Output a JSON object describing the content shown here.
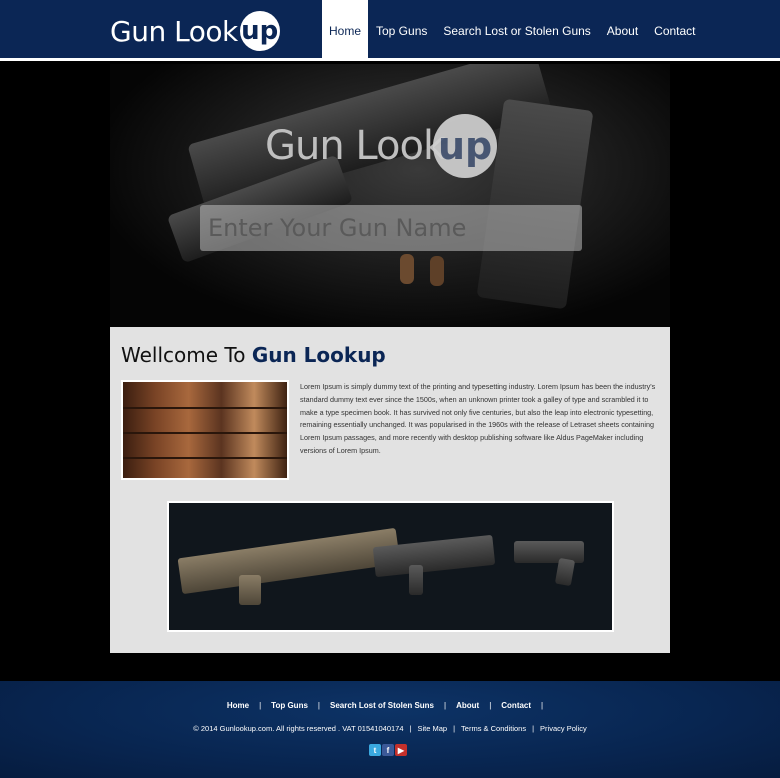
{
  "header": {
    "logo_text": "Gun Look",
    "logo_badge": "up",
    "nav": [
      {
        "label": "Home"
      },
      {
        "label": "Top Guns"
      },
      {
        "label": "Search Lost or Stolen Guns"
      },
      {
        "label": "About"
      },
      {
        "label": "Contact"
      }
    ]
  },
  "hero": {
    "title_text": "Gun Look",
    "title_badge": "up",
    "search_placeholder": "Enter Your Gun Name"
  },
  "main": {
    "title_prefix": "Wellcome To ",
    "title_brand": "Gun Lookup",
    "body_text": "Lorem Ipsum is simply dummy text of the printing and typesetting industry. Lorem Ipsum has been the industry's standard dummy text ever since the 1500s, when an unknown printer took a galley of type and scrambled it to make a type specimen book. It has survived not only five centuries, but also the leap into electronic typesetting, remaining essentially unchanged. It was popularised in the 1960s with the release of Letraset sheets containing Lorem Ipsum passages, and more recently with desktop publishing software like Aldus PageMaker including versions of Lorem Ipsum."
  },
  "footer": {
    "nav": [
      {
        "label": "Home"
      },
      {
        "label": "Top Guns"
      },
      {
        "label": "Search Lost of Stolen Suns"
      },
      {
        "label": "About"
      },
      {
        "label": "Contact"
      }
    ],
    "copyright": "© 2014 Gunlookup.com. All rights reserved . VAT 01541040174",
    "links": [
      {
        "label": "Site Map"
      },
      {
        "label": "Terms & Conditions"
      },
      {
        "label": "Privacy Policy"
      }
    ],
    "social_icons": [
      "twitter-icon",
      "facebook-icon",
      "youtube-icon"
    ]
  },
  "colors": {
    "brand_navy": "#0b2655",
    "panel_bg": "#e2e2e2"
  }
}
